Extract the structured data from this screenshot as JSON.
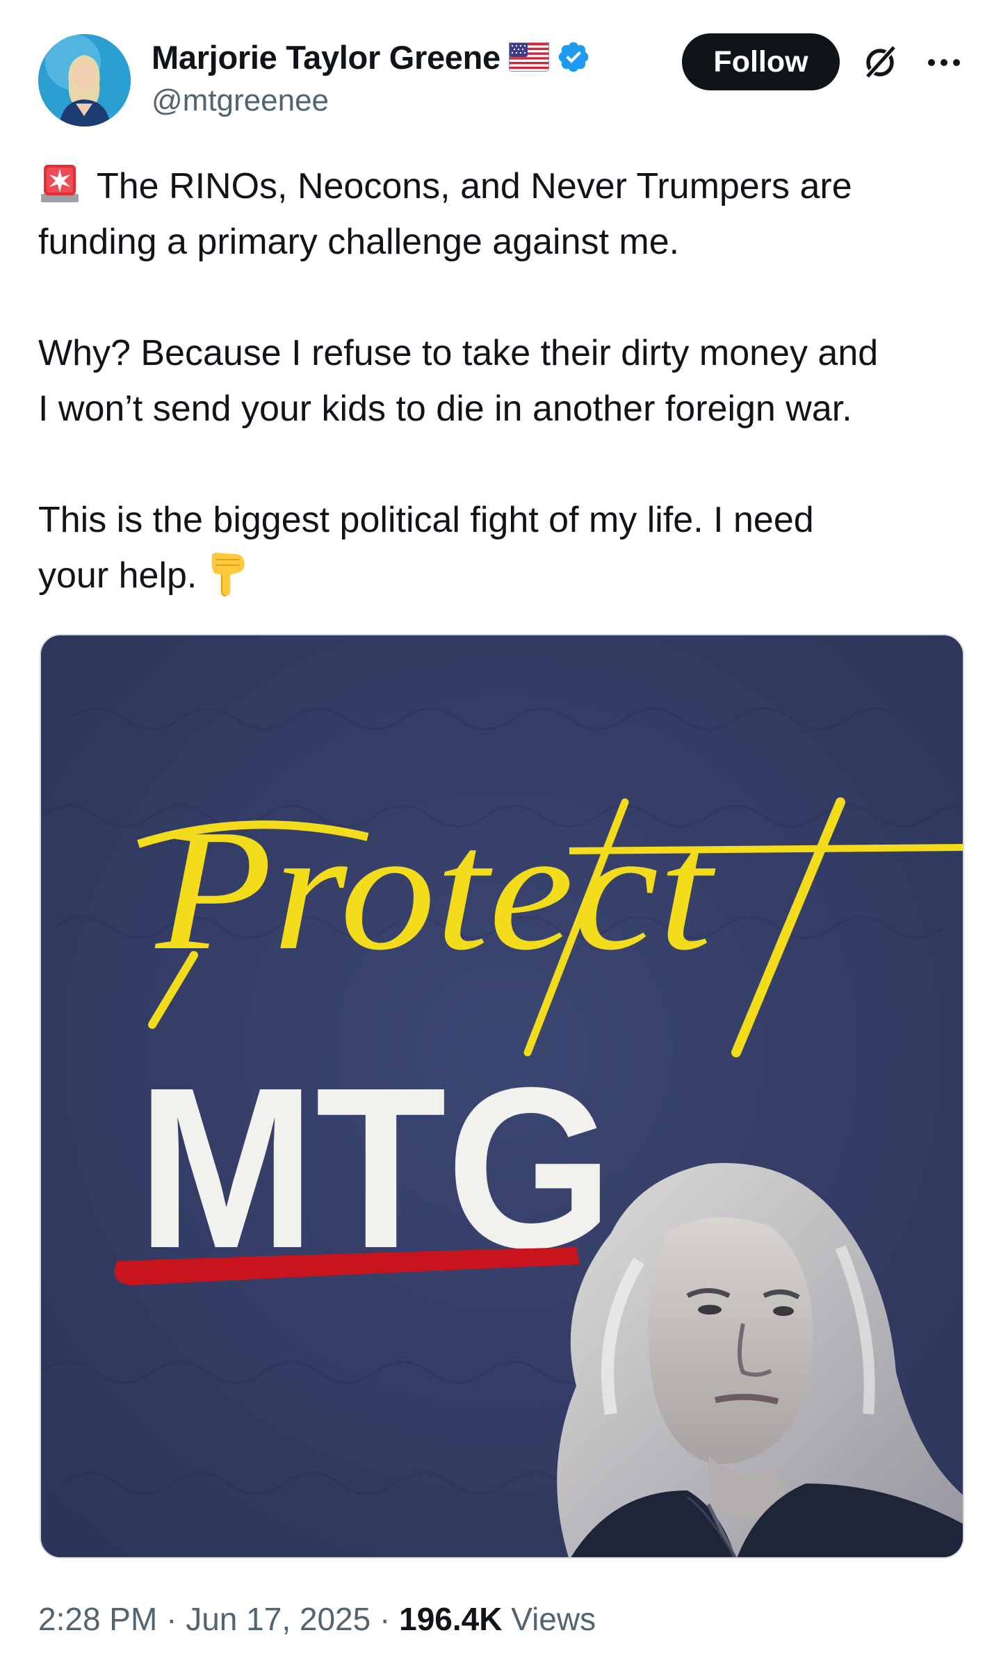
{
  "author": {
    "display_name": "Marjorie Taylor Greene",
    "handle": "@mtgreenee",
    "flag_icon": "us-flag-icon",
    "verified_icon": "verified-badge-icon",
    "verified_color": "#1d9bf0"
  },
  "actions": {
    "follow_label": "Follow",
    "grok_icon": "grok-icon",
    "more_icon": "more-icon"
  },
  "tweet": {
    "para1_line1": "The RINOs, Neocons, and Never Trumpers are",
    "para1_line2": "funding a primary challenge against me.",
    "para2_line1": "Why? Because I refuse to take their dirty money and",
    "para2_line2": "I won’t send your kids to die in another foreign war.",
    "para3_line1": "This is the biggest political fight of my life. I need",
    "para3_line2": "your help.",
    "emoji_start": "police-light-emoji",
    "emoji_end": "backhand-index-pointing-down-emoji"
  },
  "media": {
    "script_word": "Protect",
    "block_word": "MTG",
    "script_color": "#f2dc1b",
    "underline_color": "#c8141c",
    "background_color": "#343d63"
  },
  "meta": {
    "time": "2:28 PM",
    "separator": " · ",
    "date": "Jun 17, 2025",
    "views_count": "196.4K",
    "views_label": "Views"
  },
  "colors": {
    "text_primary": "#0f1419",
    "text_secondary": "#536471",
    "follow_bg": "#0f1419"
  }
}
